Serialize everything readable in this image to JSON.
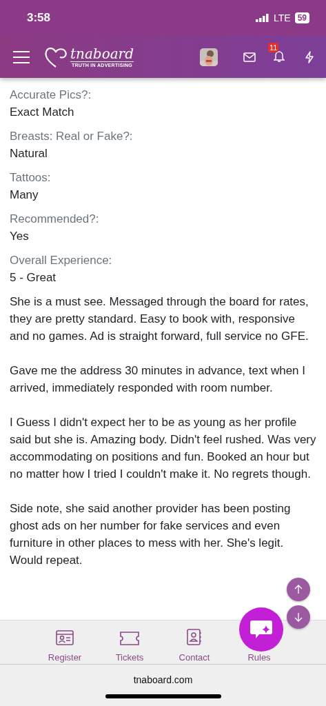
{
  "status_bar": {
    "time": "3:58",
    "network": "LTE",
    "battery": "59"
  },
  "header": {
    "logo": {
      "name": "tnaboard",
      "tagline": "TRUTH IN ADVERTISING"
    },
    "notification_count": "11"
  },
  "fields": [
    {
      "label": "Accurate Pics?:",
      "value": "Exact Match"
    },
    {
      "label": "Breasts: Real or Fake?:",
      "value": "Natural"
    },
    {
      "label": "Tattoos:",
      "value": "Many"
    },
    {
      "label": "Recommended?:",
      "value": "Yes"
    },
    {
      "label": "Overall Experience:",
      "value": "5 - Great"
    }
  ],
  "paragraphs": [
    "She is a must see. Messaged through the board for rates, they are pretty standard. Easy to book with, responsive and no games. Ad is straight forward, full service no GFE.",
    "Gave me the address 30 minutes in advance, text when I arrived, immediately responded with room number.",
    "I Guess I didn't expect her to be as young as her profile said but she is. Amazing body. Didn't feel rushed. Was very accommodating on positions and fun. Booked an hour but no matter how I tried I couldn't make it. No regrets though.",
    "Side note, she said another provider has been posting ghost ads on her number for fake services and even furniture in other places to mess with her. She's legit. Would repeat."
  ],
  "bottom_nav": [
    {
      "label": "Register"
    },
    {
      "label": "Tickets"
    },
    {
      "label": "Contact"
    },
    {
      "label": "Rules"
    }
  ],
  "browser_bar": {
    "url": "tnaboard.com"
  }
}
